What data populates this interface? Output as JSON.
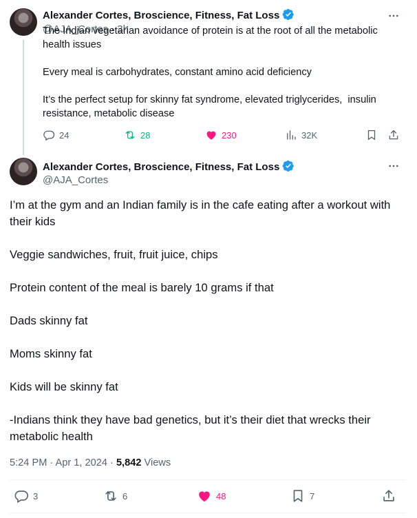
{
  "tweet1": {
    "author_name": "Alexander Cortes, Broscience, Fitness, Fat Loss",
    "handle": "@AJA_Cortes",
    "separator": "·",
    "time": "3h",
    "text": "The Indian vegetarian avoidance of protein is at the root of all the metabolic health issues\n\nEvery meal is carbohydrates, constant amino acid deficiency\n\nIt’s the perfect setup for skinny fat syndrome, elevated triglycerides,  insulin resistance, metabolic disease",
    "stats": {
      "replies": "24",
      "reposts": "28",
      "likes": "230",
      "views": "32K"
    }
  },
  "tweet2": {
    "author_name": "Alexander Cortes, Broscience, Fitness, Fat Loss",
    "handle": "@AJA_Cortes",
    "text": "I’m at the gym and an Indian family is in the cafe eating after a workout with their kids\n\nVeggie sandwiches, fruit, fruit juice, chips\n\nProtein content of the meal is barely 10 grams if that\n\nDads skinny fat\n\nMoms skinny fat\n\nKids will be skinny fat\n\n-Indians think they have bad genetics, but it’s their diet that wrecks their metabolic health",
    "timestamp": "5:24 PM · Apr 1, 2024 · ",
    "views_count": "5,842",
    "views_label": " Views",
    "stats": {
      "replies": "3",
      "reposts": "6",
      "likes": "48",
      "bookmarks": "7"
    }
  },
  "colors": {
    "verified": "#1d9bf0",
    "repost_green": "#00ba7c",
    "like_pink": "#f91880",
    "muted": "#536471"
  },
  "icons": [
    "more-icon",
    "verified-icon",
    "reply-icon",
    "repost-icon",
    "like-icon",
    "views-icon",
    "bookmark-icon",
    "share-icon"
  ]
}
